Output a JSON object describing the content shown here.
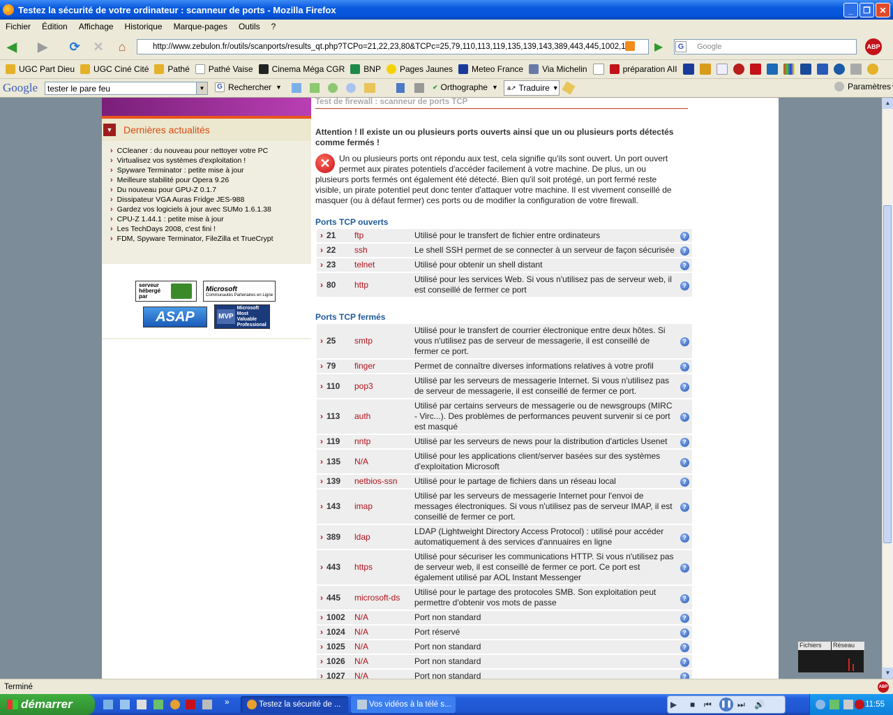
{
  "window": {
    "title": "Testez la sécurité de votre ordinateur : scanneur de ports - Mozilla Firefox"
  },
  "menu": [
    "Fichier",
    "Édition",
    "Affichage",
    "Historique",
    "Marque-pages",
    "Outils",
    "?"
  ],
  "nav": {
    "url": "http://www.zebulon.fr/outils/scanports/results_qt.php?TCPo=21,22,23,80&TCPc=25,79,110,113,119,135,139,143,389,443,445,1002,10:",
    "search_placeholder": "Google"
  },
  "bookmarks": [
    "UGC Part Dieu",
    "UGC Ciné Cité",
    "Pathé",
    "Pathé Vaise",
    "Cinema Méga CGR",
    "BNP",
    "Pages Jaunes",
    "Meteo France",
    "Via Michelin",
    "préparation AII"
  ],
  "google_toolbar": {
    "logo": "Google",
    "query": "tester le pare feu",
    "search_label": "Rechercher",
    "spell_label": "Orthographe",
    "translate_label": "Traduire",
    "settings_label": "Paramètres"
  },
  "news": {
    "title": "Dernières actualités",
    "items": [
      "CCleaner : du nouveau pour nettoyer votre PC",
      "Virtualisez vos systèmes d'exploitation !",
      "Spyware Terminator : petite mise à jour",
      "Meilleure stabilité pour Opera 9.26",
      "Du nouveau pour GPU-Z 0.1.7",
      "Dissipateur VGA Auras Fridge JES-988",
      "Gardez vos logiciels à jour avec SUMo 1.6.1.38",
      "CPU-Z 1.44.1 : petite mise à jour",
      "Les TechDays 2008, c'est fini !",
      "FDM, Spyware Terminator, FileZilla et TrueCrypt"
    ]
  },
  "logos": {
    "hosted": "serveur hébergé par",
    "ms": "Microsoft",
    "ms_sub": "Communautés Partenaires en Ligne",
    "asap": "ASAP",
    "mvp": "MVP",
    "mvp_sub": "Microsoft Most Valuable Professional"
  },
  "main": {
    "page_title": "Test de firewall : scanneur de ports TCP",
    "warning": "Attention ! Il existe un ou plusieurs ports ouverts ainsi que un ou plusieurs ports détectés comme fermés !",
    "description": "Un ou plusieurs ports ont répondu aux test, cela signifie qu'ils sont ouvert. Un port ouvert permet aux pirates potentiels d'accéder facilement à votre machine. De plus, un ou plusieurs ports fermés ont également été détecté. Bien qu'il soit protégé, un port fermé reste visible, un pirate potentiel peut donc tenter d'attaquer votre machine. Il est vivement conseillé de masquer (ou à défaut fermer) ces ports ou de modifier la configuration de votre firewall.",
    "open_title": "Ports TCP ouverts",
    "open_ports": [
      {
        "port": "21",
        "name": "ftp",
        "desc": "Utilisé pour le transfert de fichier entre ordinateurs"
      },
      {
        "port": "22",
        "name": "ssh",
        "desc": "Le shell SSH permet de se connecter à un serveur de façon sécurisée"
      },
      {
        "port": "23",
        "name": "telnet",
        "desc": "Utilisé pour obtenir un shell distant"
      },
      {
        "port": "80",
        "name": "http",
        "desc": "Utilisé pour les services Web. Si vous n'utilisez pas de serveur web, il est conseillé de fermer ce port"
      }
    ],
    "closed_title": "Ports TCP fermés",
    "closed_ports": [
      {
        "port": "25",
        "name": "smtp",
        "desc": "Utilisé pour le transfert de courrier électronique entre deux hôtes. Si vous n'utilisez pas de serveur de messagerie, il est conseillé de fermer ce port."
      },
      {
        "port": "79",
        "name": "finger",
        "desc": "Permet de connaître diverses informations relatives à votre profil"
      },
      {
        "port": "110",
        "name": "pop3",
        "desc": "Utilisé par les serveurs de messagerie Internet. Si vous n'utilisez pas de serveur de messagerie, il est conseillé de fermer ce port."
      },
      {
        "port": "113",
        "name": "auth",
        "desc": "Utilisé par certains serveurs de messagerie ou de newsgroups (MIRC - Virc...). Des problèmes de performances peuvent survenir si ce port est masqué"
      },
      {
        "port": "119",
        "name": "nntp",
        "desc": "Utilisé par les serveurs de news pour la distribution d'articles Usenet"
      },
      {
        "port": "135",
        "name": "N/A",
        "desc": "Utilisé pour les applications client/server basées sur des systèmes d'exploitation Microsoft"
      },
      {
        "port": "139",
        "name": "netbios-ssn",
        "desc": "Utilisé pour le partage de fichiers dans un réseau local"
      },
      {
        "port": "143",
        "name": "imap",
        "desc": "Utilisé par les serveurs de messagerie Internet pour l'envoi de messages électroniques. Si vous n'utilisez pas de serveur IMAP, il est conseillé de fermer ce port."
      },
      {
        "port": "389",
        "name": "ldap",
        "desc": "LDAP (Lightweight Directory Access Protocol) : utilisé pour accéder automatiquement à des services d'annuaires en ligne"
      },
      {
        "port": "443",
        "name": "https",
        "desc": "Utilisé pour sécuriser les communications HTTP. Si vous n'utilisez pas de serveur web, il est conseillé de fermer ce port. Ce port est également utilisé par AOL Instant Messenger"
      },
      {
        "port": "445",
        "name": "microsoft-ds",
        "desc": "Utilisé pour le partage des protocoles SMB. Son exploitation peut permettre d'obtenir vos mots de passe"
      },
      {
        "port": "1002",
        "name": "N/A",
        "desc": "Port non standard"
      },
      {
        "port": "1024",
        "name": "N/A",
        "desc": "Port réservé"
      },
      {
        "port": "1025",
        "name": "N/A",
        "desc": "Port non standard"
      },
      {
        "port": "1026",
        "name": "N/A",
        "desc": "Port non standard"
      },
      {
        "port": "1027",
        "name": "N/A",
        "desc": "Port non standard"
      }
    ]
  },
  "status": "Terminé",
  "netmon": {
    "files": "Fichiers",
    "network": "Réseau"
  },
  "taskbar": {
    "start": "démarrer",
    "tasks": [
      "Testez la sécurité de ...",
      "Vos vidéos à la télé s..."
    ],
    "clock": "11:55"
  }
}
